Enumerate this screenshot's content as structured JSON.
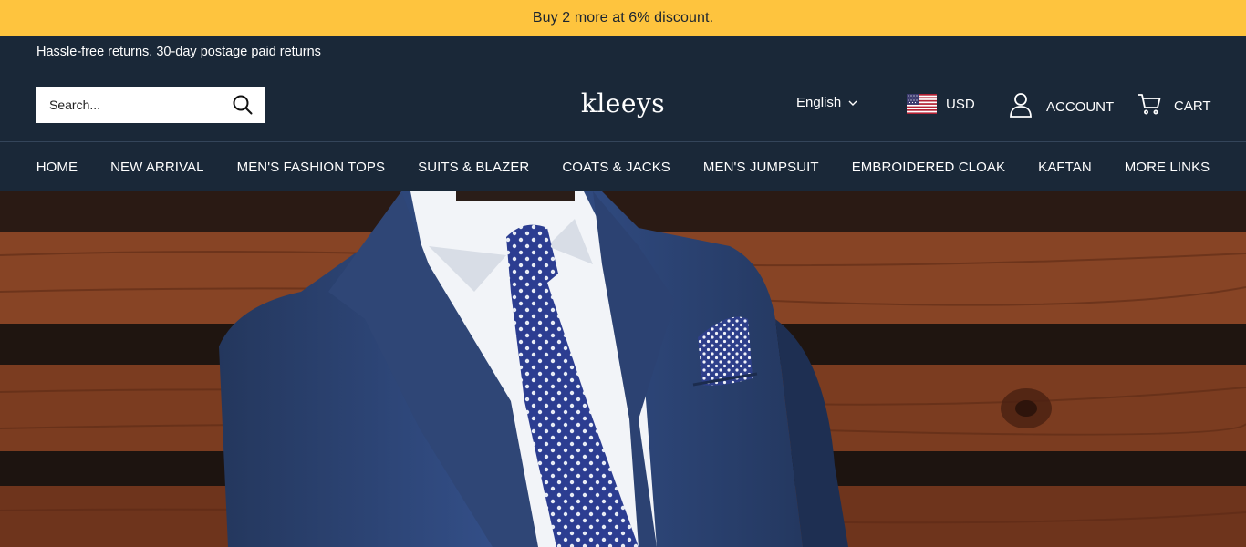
{
  "promo": {
    "text": "Buy 2 more at 6% discount."
  },
  "info_bar": {
    "text": "Hassle-free returns. 30-day postage paid returns"
  },
  "header": {
    "search": {
      "placeholder": "Search...",
      "value": ""
    },
    "logo": "kleeys",
    "language": "English",
    "currency": "USD",
    "account_label": "ACCOUNT",
    "cart_label": "CART"
  },
  "nav": {
    "items": [
      {
        "label": "HOME"
      },
      {
        "label": "NEW ARRIVAL"
      },
      {
        "label": "MEN'S FASHION TOPS"
      },
      {
        "label": "SUITS & BLAZER"
      },
      {
        "label": "COATS & JACKS"
      },
      {
        "label": "MEN'S JUMPSUIT"
      },
      {
        "label": "EMBROIDERED CLOAK"
      },
      {
        "label": "KAFTAN"
      },
      {
        "label": "MORE LINKS"
      }
    ]
  },
  "colors": {
    "promo_bg": "#fec43e",
    "header_bg": "#1a2838",
    "divider": "#34455a",
    "text": "#ffffff",
    "wood": "#7a3d22",
    "suit": "#2b3f6c",
    "tie": "#2a3c8c"
  },
  "icons": {
    "search": "search-icon",
    "language_dropdown": "chevron-down-icon",
    "flag": "us-flag-icon",
    "account": "user-icon",
    "cart": "cart-icon"
  }
}
